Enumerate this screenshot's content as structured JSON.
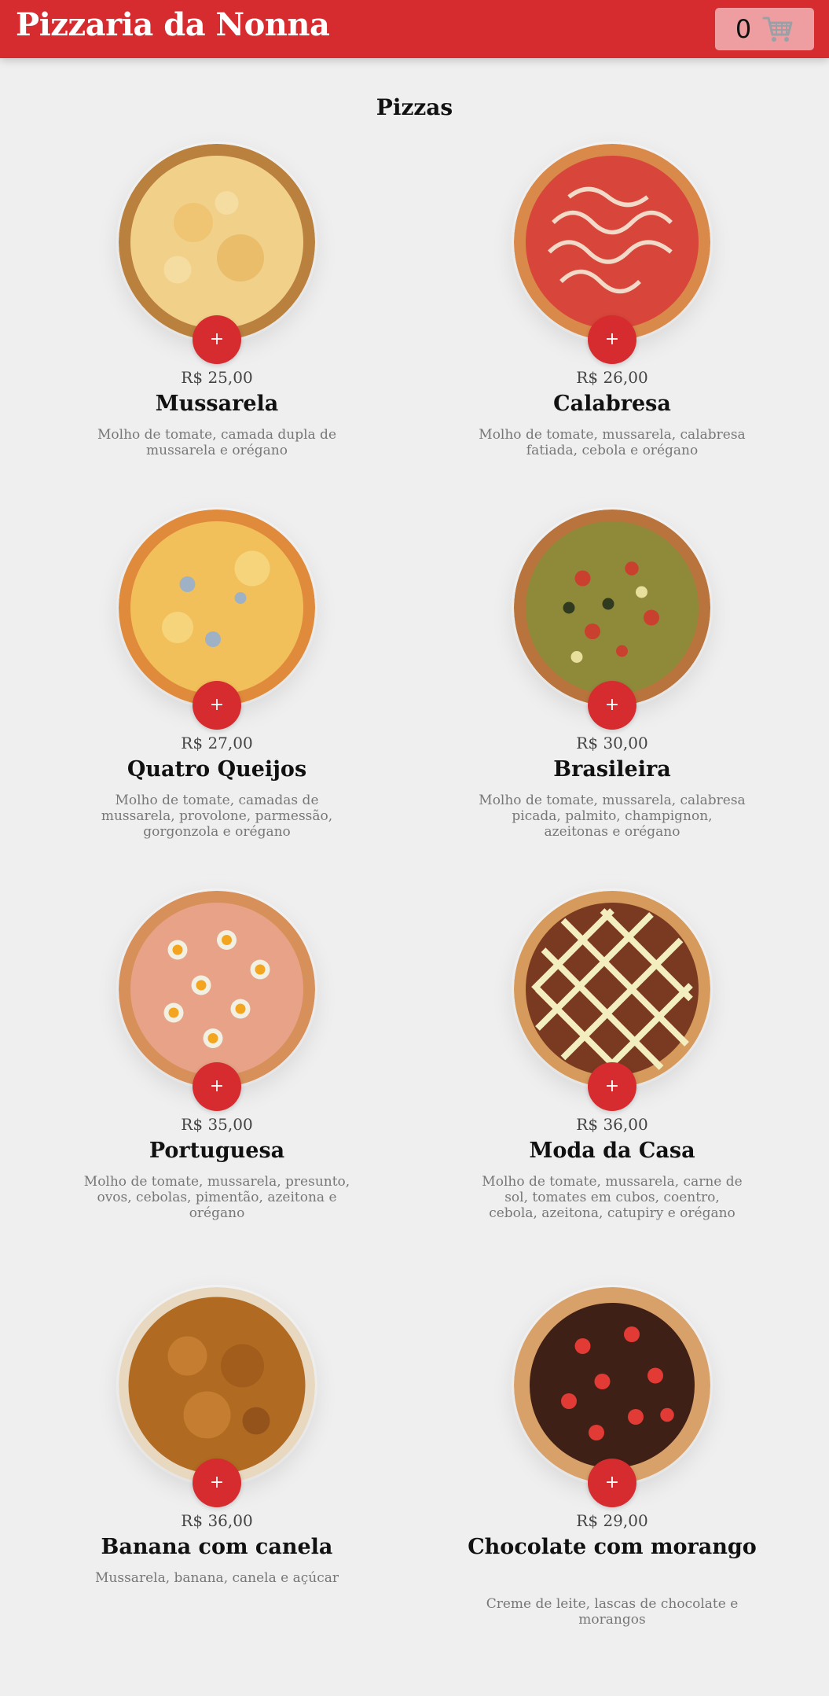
{
  "header": {
    "brand": "Pizzaria da Nonna",
    "cart_count": "0",
    "cart_icon": "shopping-cart-icon",
    "accent": "#d62b2f"
  },
  "menu": {
    "section_title": "Pizzas",
    "add_label": "+",
    "pizzas": [
      {
        "price": "R$ 25,00",
        "name": "Mussarela",
        "desc": "Molho de tomate, camada dupla de mussarela e orégano",
        "topping": "cheese"
      },
      {
        "price": "R$ 26,00",
        "name": "Calabresa",
        "desc": "Molho de tomate, mussarela, calabresa fatiada, cebola e orégano",
        "topping": "calabresa"
      },
      {
        "price": "R$ 27,00",
        "name": "Quatro Queijos",
        "desc": "Molho de tomate, camadas de mussarela, provolone, parmessão, gorgonzola e orégano",
        "topping": "four-cheese"
      },
      {
        "price": "R$ 30,00",
        "name": "Brasileira",
        "desc": "Molho de tomate, mussarela, calabresa picada, palmito, champignon, azeitonas e orégano",
        "topping": "brasileira"
      },
      {
        "price": "R$ 35,00",
        "name": "Portuguesa",
        "desc": "Molho de tomate, mussarela, presunto, ovos, cebolas, pimentão, azeitona e orégano",
        "topping": "portuguesa"
      },
      {
        "price": "R$ 36,00",
        "name": "Moda da Casa",
        "desc": "Molho de tomate, mussarela, carne de sol, tomates em cubos, coentro, cebola, azeitona, catupiry e orégano",
        "topping": "moda-casa"
      },
      {
        "price": "R$ 36,00",
        "name": "Banana com canela",
        "desc": "Mussarela, banana, canela e açúcar",
        "topping": "banana"
      },
      {
        "price": "R$ 29,00",
        "name": "Chocolate com morango",
        "desc": "Creme de leite, lascas de chocolate e morangos",
        "topping": "chocolate"
      }
    ]
  }
}
